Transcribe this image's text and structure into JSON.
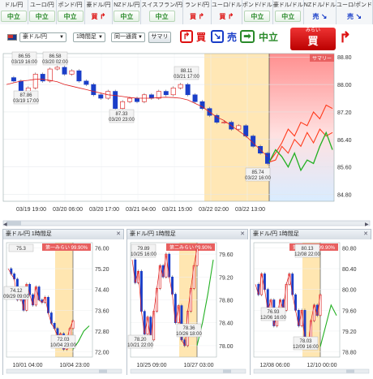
{
  "strip": [
    {
      "pair": "ドル/円",
      "signal": "中立",
      "kind": "neutral"
    },
    {
      "pair": "ユーロ/円",
      "signal": "中立",
      "kind": "neutral"
    },
    {
      "pair": "ポンド/円",
      "signal": "中立",
      "kind": "neutral"
    },
    {
      "pair": "豪ドル/円",
      "signal": "買",
      "kind": "buy"
    },
    {
      "pair": "NZドル/円",
      "signal": "中立",
      "kind": "neutral"
    },
    {
      "pair": "スイスフラン/円",
      "signal": "中立",
      "kind": "neutral"
    },
    {
      "pair": "ランド/円",
      "signal": "買",
      "kind": "buy"
    },
    {
      "pair": "ユーロ/ドル",
      "signal": "買",
      "kind": "buy"
    },
    {
      "pair": "ポンド/ドル",
      "signal": "中立",
      "kind": "neutral"
    },
    {
      "pair": "豪ドル/ドル",
      "signal": "中立",
      "kind": "neutral"
    },
    {
      "pair": "NZドル/ドル",
      "signal": "売",
      "kind": "sell"
    },
    {
      "pair": "ユーロ/ポンド",
      "signal": "売",
      "kind": "sell"
    }
  ],
  "toolbar": {
    "pair_select": "豪ドル/円",
    "timeframe_select": "1時間足",
    "similar_select": "同一通貨",
    "summary_button": "サマリ",
    "buy_label": "買",
    "sell_label": "売",
    "neutral_label": "中立",
    "recommend_small": "みらい",
    "recommend_big": "買"
  },
  "colors": {
    "buy": "#dd1111",
    "sell": "#1a3ec8",
    "neutral": "#2a8a2a",
    "highlight": "#ffe3a8",
    "forecast_bg": "#ff9a9a"
  },
  "chart_data": [
    {
      "type": "line",
      "title": "豪ドル/円 1時間足",
      "summary_tag": "サマリー",
      "x_ticks": [
        "03/19 19:00",
        "03/20 06:00",
        "03/20 17:00",
        "03/21 04:00",
        "03/21 15:00",
        "03/22 02:00",
        "03/22 13:00"
      ],
      "y_ticks": [
        "88.80",
        "88.00",
        "87.20",
        "86.40",
        "85.60",
        "84.80"
      ],
      "ylim": [
        84.6,
        88.9
      ],
      "price": [
        88.2,
        88.1,
        87.6,
        87.9,
        88.3,
        88.1,
        88.45,
        88.5,
        88.3,
        88.4,
        88.1,
        88.0,
        87.7,
        87.6,
        87.8,
        87.3,
        87.5,
        87.6,
        87.5,
        87.7,
        87.6,
        87.8,
        87.7,
        87.9,
        88.0,
        87.7,
        87.5,
        87.3,
        87.1,
        86.9,
        86.9,
        86.7,
        86.8,
        86.5,
        86.2,
        86.0,
        85.7
      ],
      "ma": [
        88.0,
        88.05,
        88.1,
        88.12,
        88.15,
        88.15,
        88.12,
        88.08,
        88.0,
        87.95,
        87.9,
        87.85,
        87.8,
        87.75,
        87.7,
        87.68,
        87.65,
        87.62,
        87.6,
        87.6,
        87.6,
        87.62,
        87.63,
        87.62,
        87.6,
        87.55,
        87.45,
        87.35,
        87.2,
        87.05,
        86.95,
        86.8,
        86.65,
        86.5,
        86.3,
        86.1,
        85.9
      ],
      "forecast_red_1": [
        85.74,
        86.0,
        86.3,
        86.7,
        86.5,
        86.9,
        86.8,
        87.2,
        87.0,
        87.4,
        87.3
      ],
      "forecast_red_2": [
        85.74,
        85.8,
        86.2,
        86.0,
        86.4,
        86.2,
        86.6,
        86.3,
        86.7,
        86.5,
        86.6
      ],
      "forecast_green": [
        85.74,
        86.1,
        85.9,
        85.6,
        86.0,
        85.5,
        85.8,
        85.7,
        86.2,
        86.6,
        86.1
      ],
      "annotations": [
        {
          "date": "03/19 16:00",
          "value": "86.55"
        },
        {
          "date": "03/20 02:00",
          "value": "86.58"
        },
        {
          "date": "03/19 17:00",
          "value": "87.86"
        },
        {
          "date": "03/20 23:00",
          "value": "87.33"
        },
        {
          "date": "03/21 17:00",
          "value": "88.11"
        },
        {
          "date": "03/22 16:00",
          "value": "85.74"
        }
      ]
    },
    {
      "type": "line",
      "title": "豪ドル/円 1時間足",
      "badge": "第一みらい 99.90%",
      "x_ticks": [
        "10/01 04:00",
        "10/04 23:00"
      ],
      "y_ticks": [
        "76.00",
        "75.20",
        "74.40",
        "73.60",
        "72.80",
        "72.00"
      ],
      "ylim": [
        71.8,
        76.2
      ],
      "price": [
        75.2,
        75.0,
        74.8,
        74.0,
        74.3,
        73.6,
        74.6,
        74.2,
        73.8,
        74.5,
        74.0,
        73.9,
        74.1,
        73.5,
        73.1,
        72.9,
        72.6,
        72.7,
        72.1,
        72.5,
        72.9,
        73.2
      ],
      "forecast_green": [
        72.1,
        72.4,
        72.8,
        73.0
      ],
      "annotations": [
        {
          "date": "",
          "value": "75.3"
        },
        {
          "date": "09/29 09:00",
          "value": "74.12"
        },
        {
          "date": "10/04 23:00",
          "value": "72.03"
        }
      ]
    },
    {
      "type": "line",
      "title": "豪ドル/円 1時間足",
      "badge": "第二みらい 99.90%",
      "x_ticks": [
        "10/25 09:00",
        "10/27 03:00"
      ],
      "y_ticks": [
        "79.60",
        "79.20",
        "78.80",
        "78.40",
        "78.00"
      ],
      "ylim": [
        77.8,
        79.8
      ],
      "price": [
        79.5,
        79.1,
        79.3,
        78.6,
        78.2,
        78.5,
        78.1,
        78.6,
        79.0,
        79.4,
        79.2,
        79.6,
        79.2,
        78.9,
        78.4,
        78.7,
        78.1,
        78.0,
        78.6,
        79.0,
        79.4,
        79.7
      ],
      "forecast_green": [
        78.0,
        78.4,
        78.9,
        79.5
      ],
      "annotations": [
        {
          "date": "10/25 16:00",
          "value": "79.89"
        },
        {
          "date": "10/21 22:00",
          "value": "78.20"
        },
        {
          "date": "10/26 18:00",
          "value": "78.36"
        }
      ]
    },
    {
      "type": "line",
      "title": "豪ドル/円 1時間足",
      "badge": "第三みらい 99.90%",
      "x_ticks": [
        "12/08 06:00",
        "12/10 00:00"
      ],
      "y_ticks": [
        "80.80",
        "80.40",
        "80.00",
        "79.60",
        "79.20",
        "78.80"
      ],
      "ylim": [
        78.7,
        80.9
      ],
      "price": [
        80.1,
        79.9,
        80.3,
        80.0,
        79.6,
        79.8,
        79.3,
        79.5,
        79.8,
        79.6,
        80.1,
        80.3,
        79.9,
        79.6,
        79.3,
        79.6,
        79.0,
        78.9,
        79.4,
        79.7,
        79.5,
        79.9
      ],
      "forecast_green": [
        78.9,
        79.3,
        79.7,
        79.5
      ],
      "annotations": [
        {
          "date": "12/08 22:00",
          "value": "80.13"
        },
        {
          "date": "12/06 16:00",
          "value": "76.93"
        },
        {
          "date": "12/09 16:00",
          "value": "78.03"
        }
      ]
    }
  ]
}
